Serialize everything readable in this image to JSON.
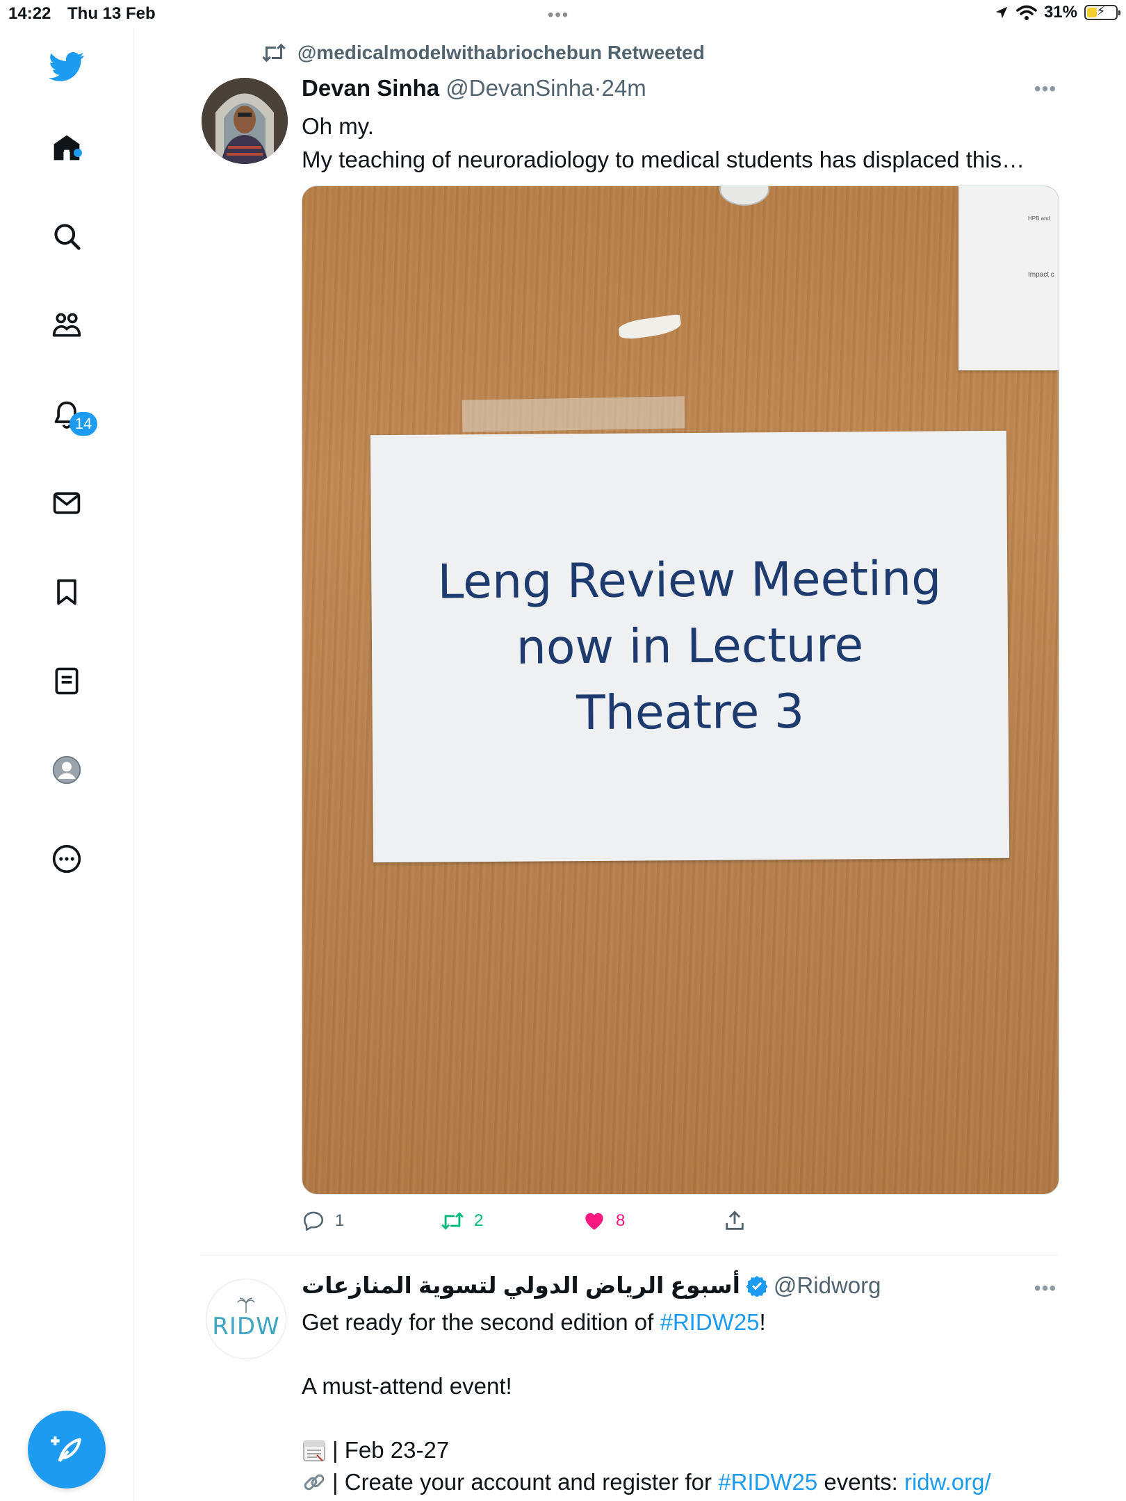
{
  "status_bar": {
    "time": "14:22",
    "date": "Thu 13 Feb",
    "battery": "31%",
    "battery_level": 0.31
  },
  "sidebar": {
    "notifications_badge": "14",
    "items": [
      "twitter-logo-icon",
      "home-icon",
      "search-icon",
      "communities-icon",
      "notifications-icon",
      "messages-icon",
      "bookmarks-icon",
      "lists-icon",
      "profile-icon",
      "more-icon"
    ]
  },
  "tweet1": {
    "retweeted_by": "@medicalmodelwithabriochebun Retweeted",
    "author_name": "Devan Sinha",
    "author_handle": "@DevanSinha",
    "separator": "·",
    "time": "24m",
    "text_line1": "Oh my.",
    "text_line2": "My teaching of neuroradiology to medical students has displaced this…",
    "photo": {
      "sign_line1": "Leng Review Meeting",
      "sign_line2": "now in Lecture",
      "sign_line3": "Theatre 3",
      "paper_text1": "HPB and",
      "paper_text2": "Impact c"
    },
    "replies": "1",
    "retweets": "2",
    "likes": "8",
    "colors": {
      "retweet": "#00ba7c",
      "like": "#f91880"
    }
  },
  "tweet2": {
    "author_name": "أسبوع الرياض الدولي لتسوية المنازعات",
    "author_handle": "@Ridworg",
    "avatar_logo": "RIDW",
    "text_pre": "Get ready for the second edition of ",
    "hashtag1": "#RIDW25",
    "text_post": "!",
    "line2": "A must-attend event!",
    "line3": "| Feb 23-27",
    "line4_pre": "| Create your account and register for ",
    "hashtag2": "#RIDW25",
    "line4_mid": " events: ",
    "link": "ridw.org/"
  },
  "accent_color": "#1d9bf0"
}
